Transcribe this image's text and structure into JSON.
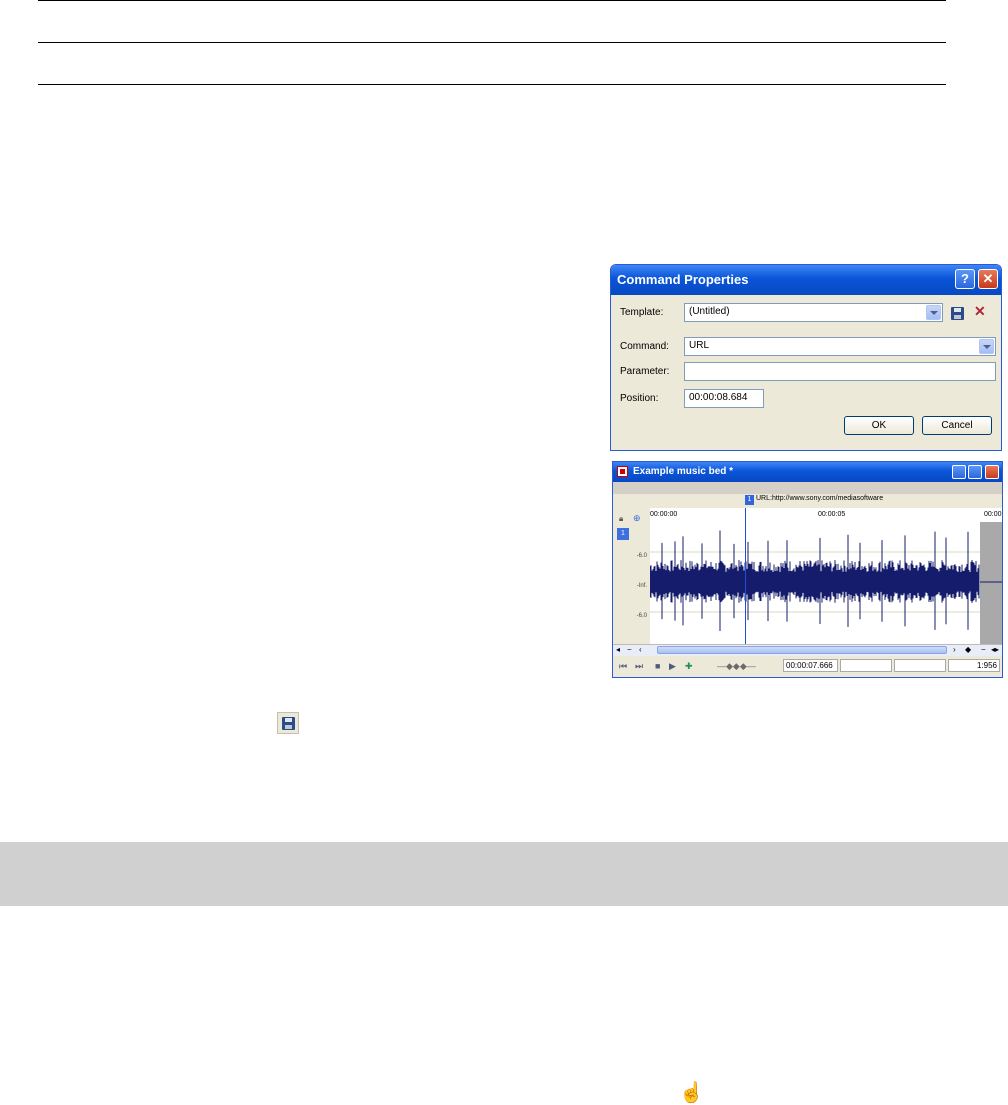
{
  "dialog": {
    "title": "Command Properties",
    "help_glyph": "?",
    "close_glyph": "✕",
    "template_label": "Template:",
    "template_value": "(Untitled)",
    "command_label": "Command:",
    "command_value": "URL",
    "parameter_label": "Parameter:",
    "parameter_value": "",
    "position_label": "Position:",
    "position_value": "00:00:08.684",
    "ok_label": "OK",
    "cancel_label": "Cancel",
    "icons": [
      "save-template-icon",
      "delete-template-icon"
    ]
  },
  "waveform_window": {
    "title": "Example music bed *",
    "marker_number": "1",
    "marker_label": "URL:http://www.sony.com/mediasoftware",
    "time_ticks": [
      "00:00:00",
      "00:00:05",
      "00:00"
    ],
    "db_labels": [
      "-6.0",
      "-Inf.",
      "-6.0"
    ],
    "cursor_time": "00:00:07.666",
    "zoom": "1:956",
    "track_badge": "1"
  },
  "colors": {
    "titlebar": "#0a55d8",
    "waveform": "#141c6b",
    "dialog_bg": "#ece9d8",
    "band": "#d0d0d0"
  }
}
